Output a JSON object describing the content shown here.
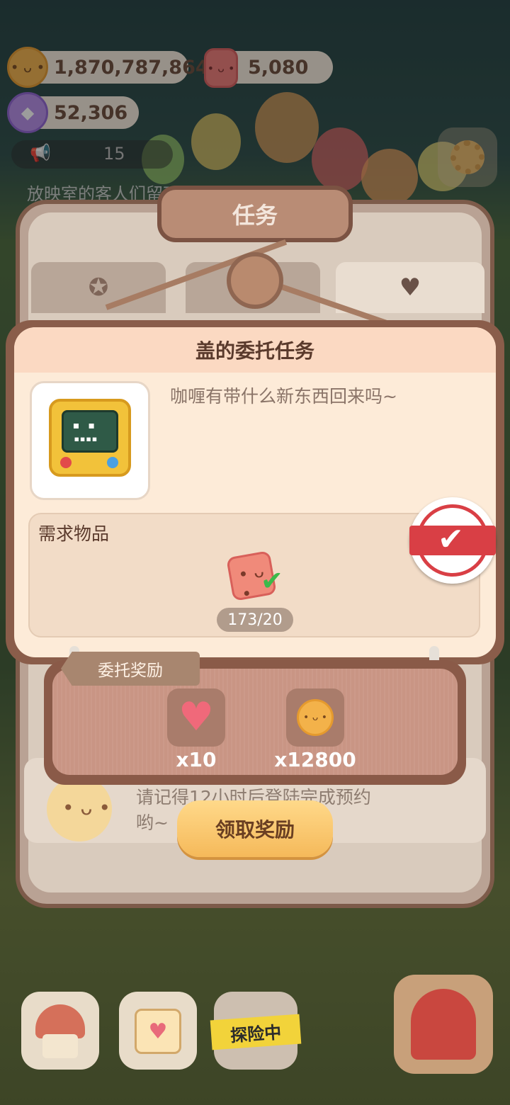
{
  "currencies": {
    "coins": "1,870,787,864",
    "candy": "5,080",
    "gems": "52,306"
  },
  "announcement": {
    "count": "15",
    "text": "放映室的客人们留下了心愿"
  },
  "panel": {
    "title": "任务"
  },
  "quest": {
    "title": "盖的委托任务",
    "dialog": "咖喱有带什么新东西回来吗~",
    "required_label": "需求物品",
    "progress": "173/20",
    "completed": true
  },
  "reward": {
    "label": "委托奖励",
    "items": [
      {
        "icon": "heart-icon",
        "qty": "x10"
      },
      {
        "icon": "cookie-coin-icon",
        "qty": "x12800"
      }
    ]
  },
  "list_preview": {
    "text": "请记得12小时后登陆完成预约哟~"
  },
  "claim_button": "领取奖励",
  "bottom_bar": {
    "expedition_label": "探险中"
  },
  "colors": {
    "accent": "#f5b95a",
    "panel_brown": "#8a5d4a",
    "card_bg": "#fdebd8"
  }
}
